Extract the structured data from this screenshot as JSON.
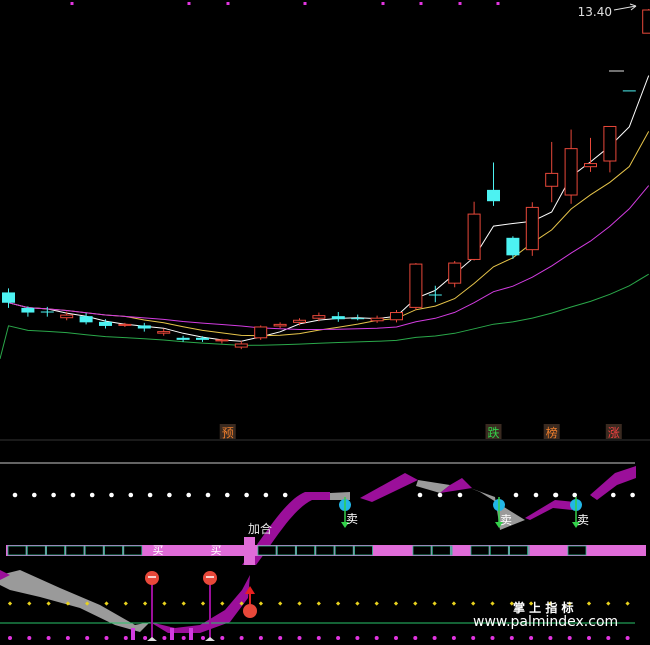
{
  "chart_data": [
    {
      "type": "candlestick",
      "price_label": "13.40",
      "candles": [
        {
          "o": 7.92,
          "c": 7.72,
          "h": 8.0,
          "l": 7.62
        },
        {
          "o": 7.62,
          "c": 7.53,
          "h": 7.65,
          "l": 7.45
        },
        {
          "o": 7.55,
          "c": 7.55,
          "h": 7.64,
          "l": 7.45
        },
        {
          "o": 7.43,
          "c": 7.48,
          "h": 7.55,
          "l": 7.38
        },
        {
          "o": 7.46,
          "c": 7.34,
          "h": 7.52,
          "l": 7.3
        },
        {
          "o": 7.35,
          "c": 7.27,
          "h": 7.4,
          "l": 7.22
        },
        {
          "o": 7.28,
          "c": 7.3,
          "h": 7.33,
          "l": 7.25
        },
        {
          "o": 7.28,
          "c": 7.22,
          "h": 7.33,
          "l": 7.16
        },
        {
          "o": 7.13,
          "c": 7.16,
          "h": 7.22,
          "l": 7.08
        },
        {
          "o": 7.04,
          "c": 7.0,
          "h": 7.08,
          "l": 6.96
        },
        {
          "o": 7.04,
          "c": 7.0,
          "h": 7.07,
          "l": 6.96
        },
        {
          "o": 6.98,
          "c": 7.0,
          "h": 7.02,
          "l": 6.93
        },
        {
          "o": 6.86,
          "c": 6.92,
          "h": 6.98,
          "l": 6.82
        },
        {
          "o": 7.04,
          "c": 7.25,
          "h": 7.28,
          "l": 7.0
        },
        {
          "o": 7.27,
          "c": 7.3,
          "h": 7.34,
          "l": 7.23
        },
        {
          "o": 7.34,
          "c": 7.38,
          "h": 7.42,
          "l": 7.28
        },
        {
          "o": 7.42,
          "c": 7.47,
          "h": 7.53,
          "l": 7.36
        },
        {
          "o": 7.46,
          "c": 7.4,
          "h": 7.54,
          "l": 7.35
        },
        {
          "o": 7.42,
          "c": 7.42,
          "h": 7.49,
          "l": 7.38
        },
        {
          "o": 7.37,
          "c": 7.42,
          "h": 7.47,
          "l": 7.33
        },
        {
          "o": 7.39,
          "c": 7.53,
          "h": 7.58,
          "l": 7.34
        },
        {
          "o": 7.63,
          "c": 8.47,
          "h": 8.49,
          "l": 7.58
        },
        {
          "o": 7.88,
          "c": 7.88,
          "h": 8.05,
          "l": 7.73
        },
        {
          "o": 8.1,
          "c": 8.49,
          "h": 8.53,
          "l": 8.02
        },
        {
          "o": 8.56,
          "c": 9.44,
          "h": 9.68,
          "l": 8.54
        },
        {
          "o": 9.91,
          "c": 9.69,
          "h": 10.44,
          "l": 9.6
        },
        {
          "o": 8.98,
          "c": 8.64,
          "h": 9.01,
          "l": 8.57
        },
        {
          "o": 8.75,
          "c": 9.57,
          "h": 9.67,
          "l": 8.63
        },
        {
          "o": 9.98,
          "c": 10.23,
          "h": 10.84,
          "l": 9.67
        },
        {
          "o": 9.81,
          "c": 10.71,
          "h": 11.08,
          "l": 9.64
        },
        {
          "o": 10.36,
          "c": 10.42,
          "h": 10.92,
          "l": 10.26
        },
        {
          "o": 10.47,
          "c": 11.14,
          "h": 11.14,
          "l": 10.25
        },
        {
          "o": 11.84,
          "c": 11.84,
          "h": 11.84,
          "l": 11.84
        },
        {
          "o": 12.95,
          "c": 13.4,
          "h": 13.42,
          "l": 12.95
        }
      ],
      "bull_color": "#e8483a",
      "bear_color": "#4df2f2",
      "ma_colors": [
        "#ffffff",
        "#e6c44a",
        "#d23ce0",
        "#2aa84a"
      ],
      "event_labels": [
        {
          "text": "预",
          "color": "#f07f2c",
          "index": 11.3
        },
        {
          "text": "跌",
          "color": "#33d14a",
          "index": 25
        },
        {
          "text": "榜",
          "color": "#f07f2c",
          "index": 28
        },
        {
          "text": "涨",
          "color": "#f04141",
          "index": 31.2
        }
      ]
    },
    {
      "type": "indicator",
      "sell_label": "卖",
      "buy_label": "买",
      "combine_label": "加合",
      "brand_label": "掌 上 指 标",
      "watermark": "www.palmindex.com",
      "band_color": "#e06cd8",
      "ribbon_color": "#9b0f9a",
      "gray_color": "#9a9a9a",
      "white_dot_color": "#ffffff",
      "yellow_dot_color": "#e8d21e",
      "magenta_dot_color": "#e235e0",
      "green_line_color": "#29c46a"
    }
  ]
}
